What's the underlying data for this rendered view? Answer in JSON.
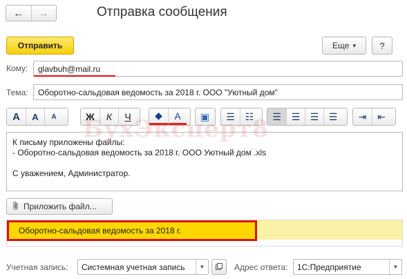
{
  "window": {
    "title": "Отправка сообщения"
  },
  "nav": {
    "back_glyph": "←",
    "forward_glyph": "→"
  },
  "toolbar": {
    "send_label": "Отправить",
    "more_label": "Еще",
    "more_glyph": "▾",
    "help_label": "?"
  },
  "form": {
    "to_label": "Кому:",
    "to_value": "glavbuh@mail.ru",
    "subject_label": "Тема:",
    "subject_value": "Оборотно-сальдовая ведомость за 2018 г. ООО \"Уютный дом\""
  },
  "format_toolbar": {
    "font": [
      "A",
      "A",
      "A"
    ],
    "style": [
      "Ж",
      "К",
      "Ч"
    ],
    "color": [
      "◆",
      "A"
    ],
    "picture": "▣",
    "lists": [
      "☰",
      "☷"
    ],
    "align": [
      "☰",
      "☰",
      "☰",
      "☰"
    ],
    "indent": [
      "⇥",
      "⇤"
    ]
  },
  "body": {
    "lines": [
      "К письму приложены файлы:",
      "- Оборотно-сальдовая ведомость за 2018 г. ООО  Уютный дом .xls",
      "",
      "С уважением, Администратор."
    ]
  },
  "watermark": {
    "text": "БухЭксперт8",
    "subtext": "...ответы на ... в 1С"
  },
  "attachments": {
    "attach_button_label": "Приложить файл...",
    "items": [
      "Оборотно-сальдовая ведомость за 2018 г."
    ]
  },
  "footer": {
    "account_label": "Учетная запись:",
    "account_value": "Системная учетная запись",
    "reply_label": "Адрес ответа:",
    "reply_value": "1С:Предприятие"
  },
  "colors": {
    "send_button": "#f5cf0d",
    "highlight": "#fcd700",
    "highlight_row": "#fbf2a7",
    "marker_red": "#d91414"
  }
}
